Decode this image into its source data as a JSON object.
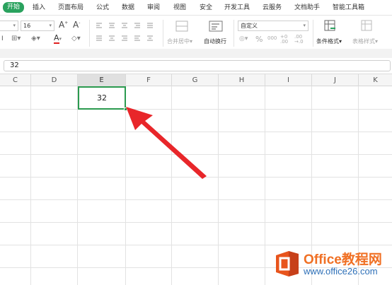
{
  "menu": {
    "items": [
      "开始",
      "插入",
      "页面布局",
      "公式",
      "数据",
      "审阅",
      "视图",
      "安全",
      "开发工具",
      "云服务",
      "文档助手",
      "智能工具箱"
    ],
    "active_index": 0,
    "active_color": "#2aa25e"
  },
  "ribbon": {
    "font_size": "16",
    "grow_font": "A",
    "shrink_font": "A",
    "font_color_letter": "A",
    "merge_center_label": "合并居中",
    "wrap_text_label": "自动换行",
    "number_format": "自定义",
    "percent_symbol": "%",
    "conditional_format_label": "条件格式",
    "table_style_label": "表格样式"
  },
  "formula_bar": {
    "value": "32"
  },
  "columns": [
    "C",
    "D",
    "E",
    "F",
    "G",
    "H",
    "I",
    "J",
    "K"
  ],
  "selected_column": "E",
  "active_cell": {
    "ref": "E",
    "value": "32",
    "border_color": "#2b9a4f"
  },
  "annotation": {
    "arrow_color": "#e8262a"
  },
  "watermark": {
    "title": "Office教程网",
    "url": "www.office26.com",
    "title_color": "#f07024",
    "url_color": "#2e70b8"
  }
}
